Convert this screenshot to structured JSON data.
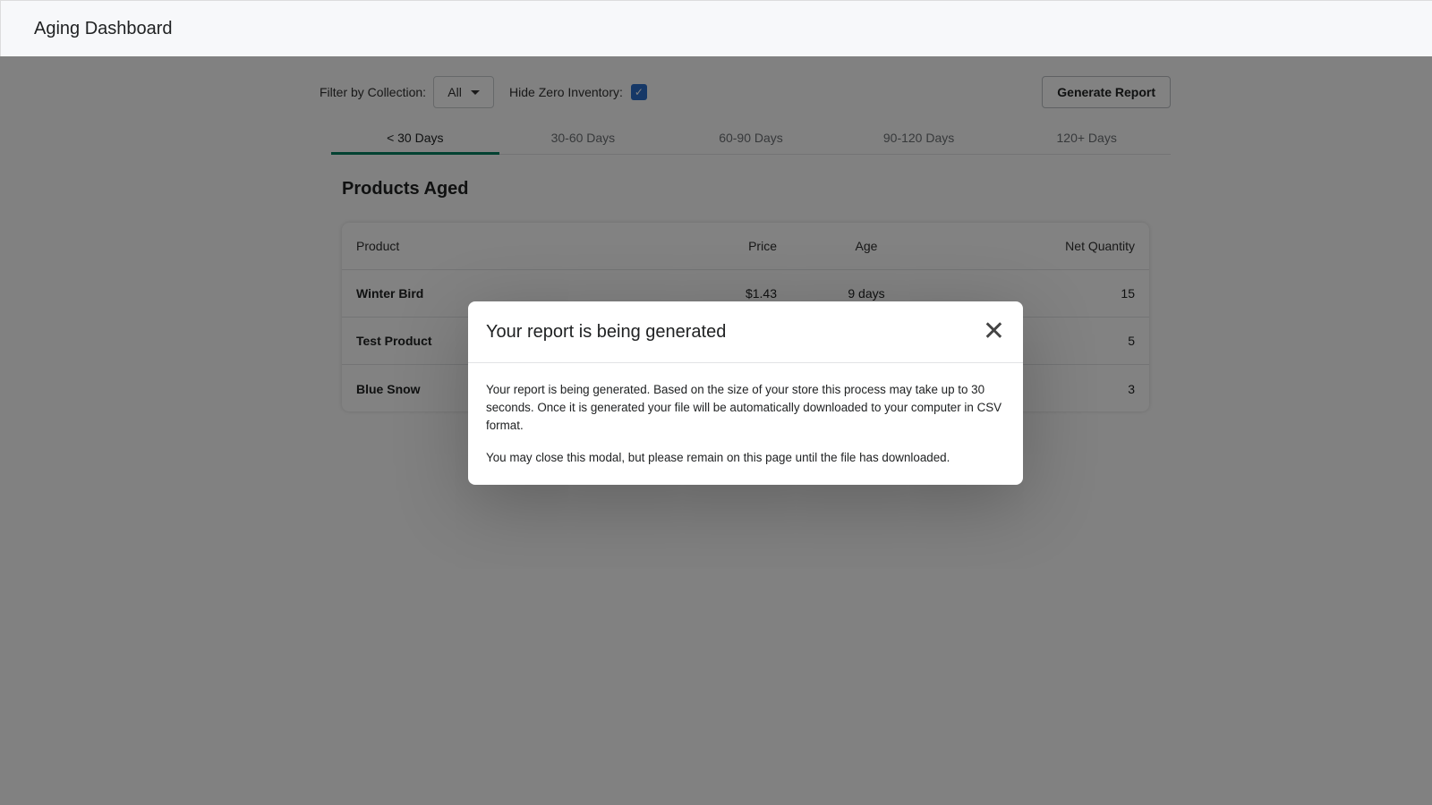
{
  "header": {
    "title": "Aging Dashboard"
  },
  "filters": {
    "collection_label": "Filter by Collection:",
    "collection_value": "All",
    "hide_zero_label": "Hide Zero Inventory:",
    "hide_zero_checked": true,
    "generate_label": "Generate Report"
  },
  "tabs": [
    {
      "label": "< 30 Days"
    },
    {
      "label": "30-60 Days"
    },
    {
      "label": "60-90 Days"
    },
    {
      "label": "90-120 Days"
    },
    {
      "label": "120+ Days"
    }
  ],
  "section_title": "Products Aged",
  "table": {
    "headers": [
      "Product",
      "Price",
      "Age",
      "Net Quantity"
    ],
    "rows": [
      [
        "Winter Bird",
        "$1.43",
        "9 days",
        "15"
      ],
      [
        "Test Product",
        "",
        "",
        "5"
      ],
      [
        "Blue Snow",
        "",
        "",
        "3"
      ]
    ]
  },
  "modal": {
    "title": "Your report is being generated",
    "body1": "Your report is being generated. Based on the size of your store this process may take up to 30 seconds. Once it is generated your file will be automatically downloaded to your computer in CSV format.",
    "body2": "You may close this modal, but please remain on this page until the file has downloaded."
  }
}
